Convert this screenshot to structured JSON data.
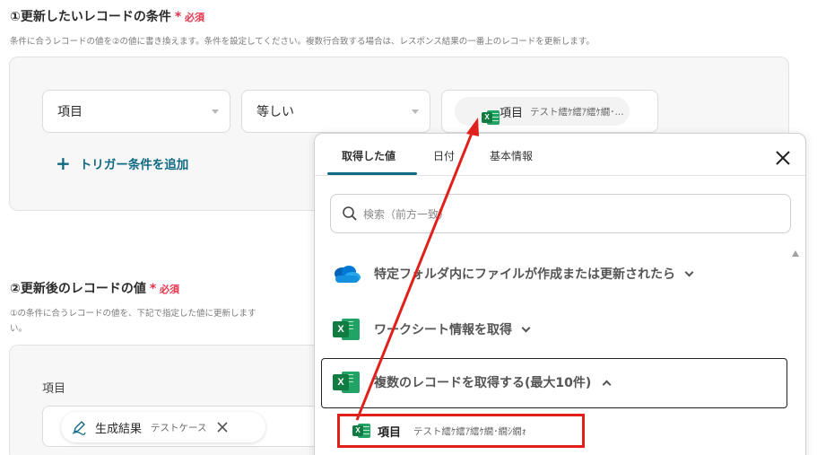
{
  "section1": {
    "title": "①更新したいレコードの条件",
    "required": "必須",
    "description": "条件に合うレコードの値を②の値に書き換えます。条件を設定してください。複数行合致する場合は、レスポンス結果の一番上のレコードを更新します。",
    "condition": {
      "field": "項目",
      "operator": "等しい",
      "value_chip": {
        "label": "項目",
        "sub": "テスト繧ｹ繧ｱ繧ｹ繝･..."
      }
    },
    "add_trigger": "トリガー条件を追加"
  },
  "section2": {
    "title": "②更新後のレコードの値",
    "required": "必須",
    "description_line1": "①の条件に合うレコードの値を、下記で指定した値に更新します",
    "description_line2": "い。",
    "field_label": "項目",
    "chip": {
      "label": "生成結果",
      "sub": "テストケース"
    }
  },
  "dropdown": {
    "tabs": [
      "取得した値",
      "日付",
      "基本情報"
    ],
    "active_tab": 0,
    "search_placeholder": "検索（前方一致）",
    "sources": [
      {
        "icon": "onedrive-icon",
        "label": "特定フォルダ内にファイルが作成または更新されたら",
        "expanded": false
      },
      {
        "icon": "excel-icon",
        "label": "ワークシート情報を取得",
        "expanded": false
      },
      {
        "icon": "excel-icon",
        "label": "複数のレコードを取得する(最大10件)",
        "expanded": true
      }
    ],
    "result_item": {
      "label": "項目",
      "value": "テスト繧ｹ繧ｱ繧ｹ繝･繝ｼ繝ｫ"
    }
  },
  "colors": {
    "required": "#e5334b",
    "accent_teal": "#0f6a84",
    "excel_green": "#107c41",
    "annotation_red": "#e0201b"
  }
}
